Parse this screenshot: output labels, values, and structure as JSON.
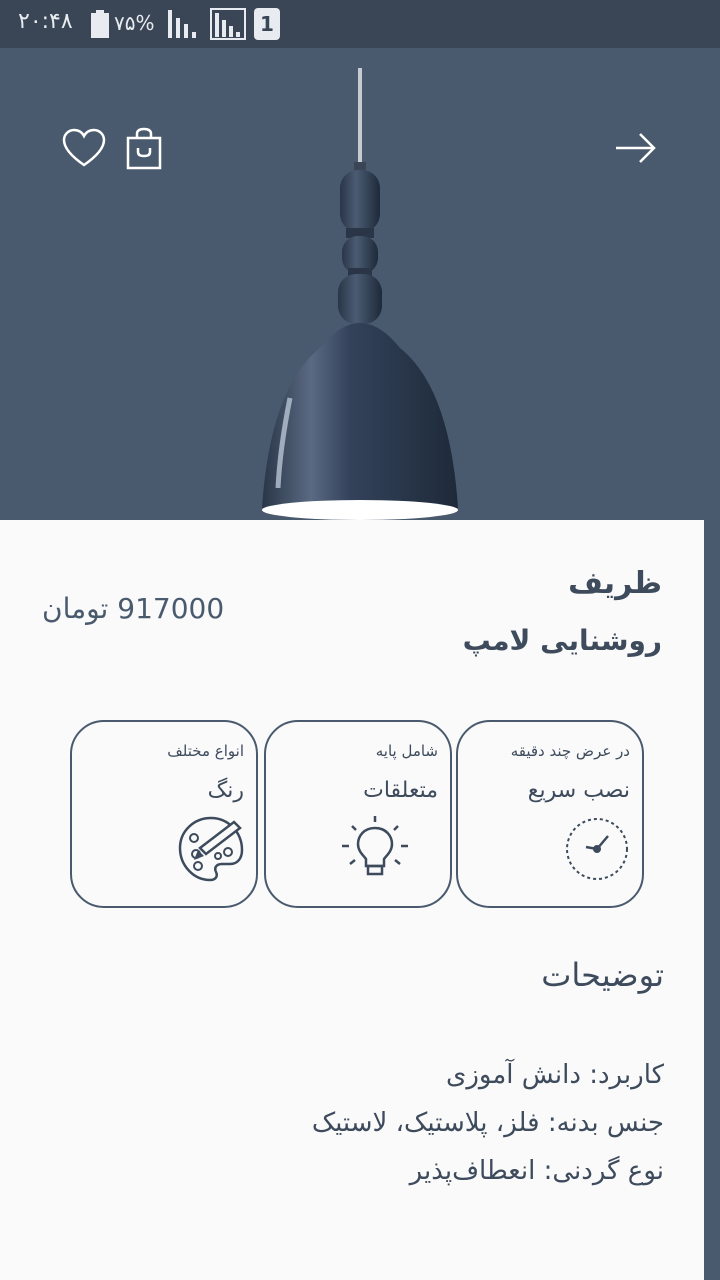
{
  "status_bar": {
    "time": "۲۰:۴۸",
    "battery_percent": "۷۵%",
    "sim_slot": "1"
  },
  "header": {
    "favorite_icon": "heart-icon",
    "bag_icon": "shopping-bag-icon",
    "back_icon": "arrow-right-icon"
  },
  "product": {
    "name": "ظریف",
    "category": "روشنایی لامپ",
    "price": "917000 تومان"
  },
  "features": [
    {
      "caption": "در عرض چند دقیقه",
      "label": "نصب سریع",
      "icon": "clock-icon"
    },
    {
      "caption": "شامل پایه",
      "label": "متعلقات",
      "icon": "lightbulb-icon"
    },
    {
      "caption": "انواع مختلف",
      "label": "رنگ",
      "icon": "palette-icon"
    }
  ],
  "description": {
    "heading": "توضیحات",
    "lines": [
      "کاربرد: دانش آموزی",
      "جنس بدنه: فلز، پلاستیک، لاستیک",
      "نوع گردنی: انعطاف‌پذیر"
    ]
  },
  "colors": {
    "primary": "#4a5a6e",
    "status_bar": "#3a4656",
    "background": "#fafafa",
    "text": "#3d4b5c"
  }
}
